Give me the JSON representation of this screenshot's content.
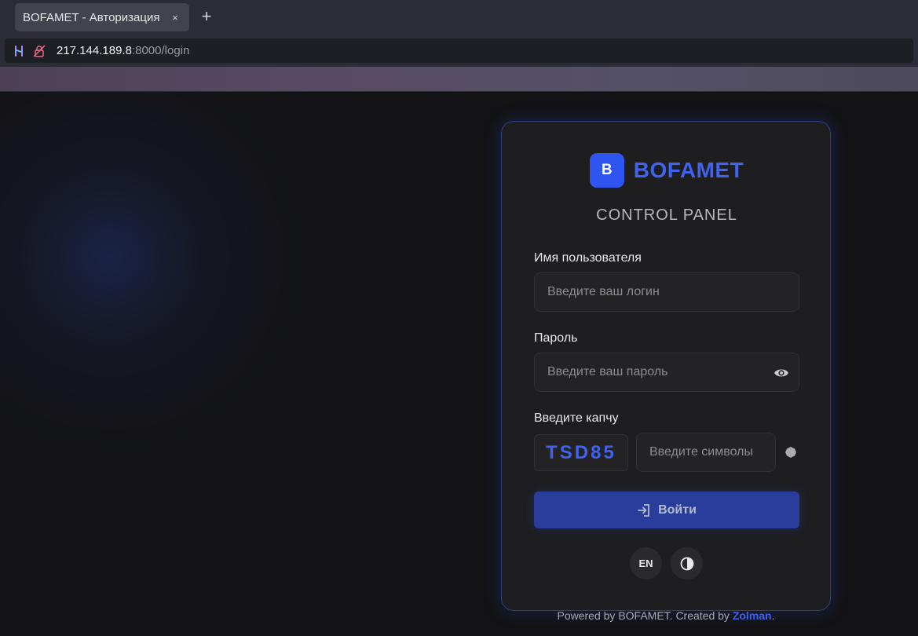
{
  "browser": {
    "tab_title": "BOFAMET - Авторизация",
    "tab_close": "×",
    "new_tab": "+",
    "url_host": "217.144.189.8",
    "url_path": ":8000/login"
  },
  "card": {
    "logo_letter": "B",
    "logo_text": "BOFAMET",
    "subtitle": "CONTROL PANEL",
    "username_label": "Имя пользователя",
    "username_placeholder": "Введите ваш логин",
    "password_label": "Пароль",
    "password_placeholder": "Введите ваш пароль",
    "captcha_label": "Введите капчу",
    "captcha_code": "TSD85",
    "captcha_placeholder": "Введите символы",
    "login_label": "Войти",
    "lang_label": "EN"
  },
  "footer": {
    "prefix": "Powered by BOFAMET. Created by ",
    "author": "Zolman",
    "suffix": "."
  },
  "icons": {
    "eye": "eye-icon",
    "refresh": "refresh-icon",
    "login": "login-icon",
    "theme": "contrast-icon"
  },
  "colors": {
    "accent": "#3f63ef",
    "button": "#2a3d9b"
  }
}
